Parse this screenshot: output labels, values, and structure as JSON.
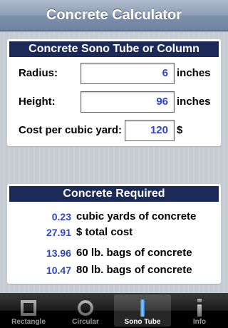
{
  "navbar": {
    "title": "Concrete Calculator"
  },
  "input_panel": {
    "header": "Concrete Sono Tube or Column",
    "radius": {
      "label": "Radius:",
      "value": "6",
      "unit": "inches"
    },
    "height": {
      "label": "Height:",
      "value": "96",
      "unit": "inches"
    },
    "cost": {
      "label": "Cost per cubic yard:",
      "value": "120",
      "unit": "$"
    }
  },
  "result_panel": {
    "header": "Concrete Required",
    "results": [
      {
        "value": "0.23",
        "text": "cubic yards of concrete"
      },
      {
        "value": "27.91",
        "text": "$ total cost"
      },
      {
        "value": "13.96",
        "text": "60 lb. bags of concrete"
      },
      {
        "value": "10.47",
        "text": "80 lb. bags of concrete"
      }
    ]
  },
  "tabbar": {
    "selected": "Sono Tube",
    "tabs": [
      {
        "label": "Rectangle",
        "icon": "square-icon"
      },
      {
        "label": "Circular",
        "icon": "circle-icon"
      },
      {
        "label": "Sono Tube",
        "icon": "tube-icon"
      },
      {
        "label": "Info",
        "icon": "info-icon"
      }
    ]
  }
}
